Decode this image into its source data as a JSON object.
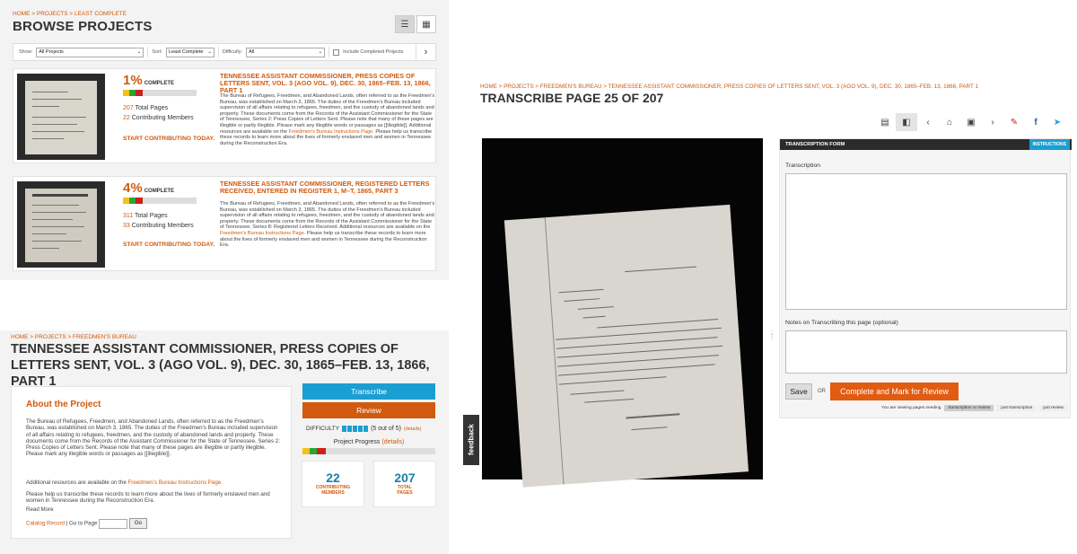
{
  "browse": {
    "breadcrumb": "HOME > PROJECTS > LEAST COMPLETE",
    "title": "BROWSE PROJECTS",
    "filters": {
      "show_label": "Show:",
      "show_value": "All Projects",
      "sort_label": "Sort:",
      "sort_value": "Least Complete",
      "difficulty_label": "Difficulty:",
      "difficulty_value": "All",
      "include_completed": "Include Completed Projects"
    },
    "projects": [
      {
        "percent": "1%",
        "complete_label": "COMPLETE",
        "total_pages_num": "207",
        "total_pages_label": "Total Pages",
        "members_num": "22",
        "members_label": "Contributing Members",
        "cta": "START CONTRIBUTING TODAY.",
        "title": "TENNESSEE ASSISTANT COMMISSIONER, PRESS COPIES OF LETTERS SENT, VOL. 3 (AGO VOL. 9), DEC. 30, 1865–FEB. 13, 1866, PART 1",
        "desc": "The Bureau of Refugees, Freedmen, and Abandoned Lands, often referred to as the Freedmen's Bureau, was established on March 3, 1865. The duties of the Freedmen's Bureau included supervision of all affairs relating to refugees, freedmen, and the custody of abandoned lands and property. These documents come from the Records of the Assistant Commissioner for the State of Tennessee, Series 2: Press Copies of Letters Sent. Please note that many of these pages are illegible or partly illegible. Please mark any illegible words or passages as [[illegible]]. Additional resources are available on the",
        "desc_link": "Freedmen's Bureau Instructions Page.",
        "desc_tail": "Please help us transcribe these records to learn more about the lives of formerly enslaved men and women in Tennessee during the Reconstruction Era."
      },
      {
        "percent": "4%",
        "complete_label": "COMPLETE",
        "total_pages_num": "311",
        "total_pages_label": "Total Pages",
        "members_num": "33",
        "members_label": "Contributing Members",
        "cta": "START CONTRIBUTING TODAY.",
        "title": "TENNESSEE ASSISTANT COMMISSIONER, REGISTERED LETTERS RECEIVED, ENTERED IN REGISTER 1, M–T, 1865, PART 3",
        "desc": "The Bureau of Refugees, Freedmen, and Abandoned Lands, often referred to as the Freedmen's Bureau, was established on March 3, 1865. The duties of the Freedmen's Bureau included supervision of all affairs relating to refugees, freedmen, and the custody of abandoned lands and property. These documents come from the Records of the Assistant Commissioner for the State of Tennessee, Series 8: Registered Letters Received. Additional resources are available on the",
        "desc_link": "Freedmen's Bureau Instructions Page.",
        "desc_tail": "Please help us transcribe these records to learn more about the lives of formerly enslaved men and women in Tennessee during the Reconstruction Era."
      }
    ]
  },
  "project": {
    "breadcrumb": "HOME > PROJECTS > FREEDMEN'S BUREAU",
    "title": "TENNESSEE ASSISTANT COMMISSIONER, PRESS COPIES OF LETTERS SENT, VOL. 3 (AGO VOL. 9), DEC. 30, 1865–FEB. 13, 1866, PART 1",
    "about_heading": "About the Project",
    "about_p1": "The Bureau of Refugees, Freedmen, and Abandoned Lands, often referred to as the Freedmen's Bureau, was established on March 3, 1865. The duties of the Freedmen's Bureau included supervision of all affairs relating to refugees, freedmen, and the custody of abandoned lands and property. These documents come from the Records of the Assistant Commissioner for the State of Tennessee, Series 2: Press Copies of Letters Sent. Please note that many of these pages are illegible or partly illegible. Please mark any illegible words or passages as [[illegible]].",
    "about_p2_pre": "Additional resources are available on the",
    "about_p2_link": "Freedmen's Bureau Instructions Page.",
    "about_p3": "Please help us transcribe these records to learn more about the lives of formerly enslaved men and women in Tennessee during the Reconstruction Era.",
    "read_more": "Read More",
    "catalog_record": "Catalog Record",
    "goto_label": "| Go to Page",
    "go_button": "Go",
    "transcribe_button": "Transcribe",
    "review_button": "Review",
    "difficulty_label": "DIFFICULTY",
    "difficulty_text": "(5 out of 5)",
    "difficulty_level": 5,
    "difficulty_details": "(details)",
    "progress_label": "Project Progress",
    "progress_details": "(details)",
    "members_num": "22",
    "members_label": "CONTRIBUTING MEMBERS",
    "pages_num": "207",
    "pages_label": "TOTAL PAGES"
  },
  "transcribe": {
    "breadcrumb": "HOME > PROJECTS > FREEDMEN'S BUREAU > TENNESSEE ASSISTANT COMMISSIONER, PRESS COPIES OF LETTERS SENT, VOL. 3 (AGO VOL. 9), DEC. 30, 1865–FEB. 13, 1866, PART 1",
    "title": "TRANSCRIBE PAGE 25 OF 207",
    "feedback": "feedback",
    "form_header": "TRANSCRIPTION FORM",
    "instructions": "INSTRUCTIONS",
    "transcription_label": "Transcription",
    "notes_label": "Notes on Transcribing this page (optional)",
    "save": "Save",
    "or": "OR",
    "complete": "Complete and Mark for Review",
    "needing_label": "You are viewing pages needing",
    "needing_options": [
      "transcription or review",
      "just transcription",
      "just review"
    ]
  },
  "colors": {
    "accent": "#d15a0e",
    "blue": "#1b9ed1",
    "green": "#2aa636",
    "yellow": "#f2c318",
    "red": "#cc1f1f"
  }
}
